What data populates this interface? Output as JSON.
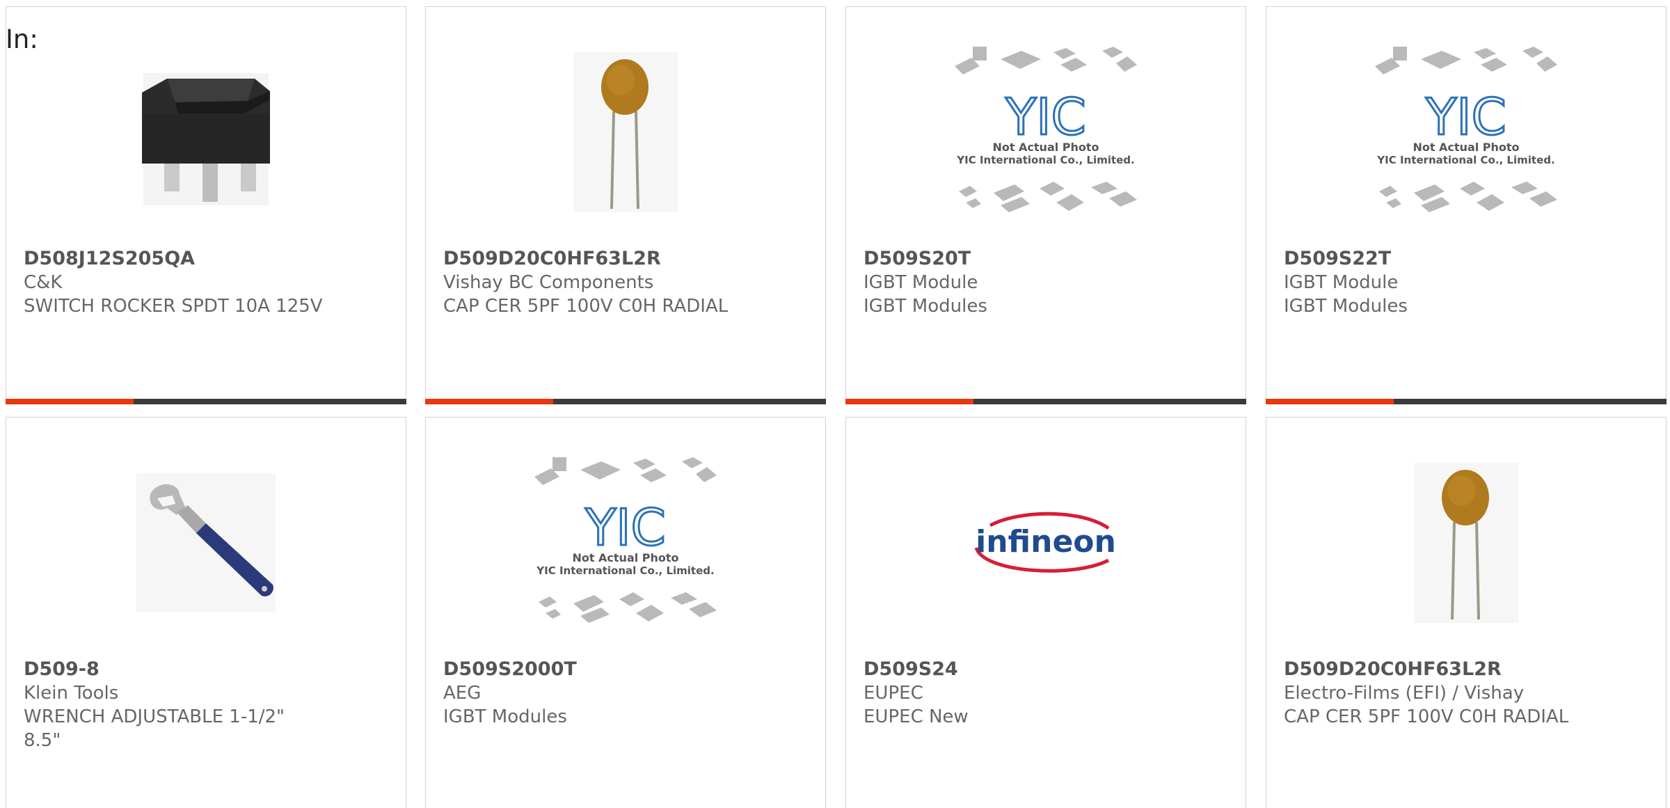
{
  "header": {
    "in_label": "In:"
  },
  "colors": {
    "accent": "#e8380d",
    "bar_dark": "#3a3a3a",
    "border": "#d2d2d2"
  },
  "products": [
    {
      "part": "D508J12S205QA",
      "maker": "C&K",
      "desc": "SWITCH ROCKER SPDT 10A 125V",
      "image": "rocker-switch"
    },
    {
      "part": "D509D20C0HF63L2R",
      "maker": "Vishay BC Components",
      "desc": "CAP CER 5PF 100V C0H RADIAL",
      "image": "ceramic-capacitor"
    },
    {
      "part": "D509S20T",
      "maker": "IGBT Module",
      "desc": "IGBT Modules",
      "image": "yic-placeholder"
    },
    {
      "part": "D509S22T",
      "maker": "IGBT Module",
      "desc": "IGBT Modules",
      "image": "yic-placeholder"
    },
    {
      "part": "D509-8",
      "maker": "Klein Tools",
      "desc": "WRENCH ADJUSTABLE 1-1/2\" 8.5\"",
      "image": "adjustable-wrench"
    },
    {
      "part": "D509S2000T",
      "maker": "AEG",
      "desc": "IGBT Modules",
      "image": "yic-placeholder"
    },
    {
      "part": "D509S24",
      "maker": "EUPEC",
      "desc": "EUPEC New",
      "image": "infineon-logo"
    },
    {
      "part": "D509D20C0HF63L2R",
      "maker": "Electro-Films (EFI) / Vishay",
      "desc": "CAP CER 5PF 100V C0H RADIAL",
      "image": "ceramic-capacitor"
    }
  ],
  "placeholder": {
    "logo_text": "YIC",
    "line1": "Not Actual Photo",
    "line2": "YIC International Co., Limited."
  },
  "infineon": {
    "text": "infineon"
  }
}
